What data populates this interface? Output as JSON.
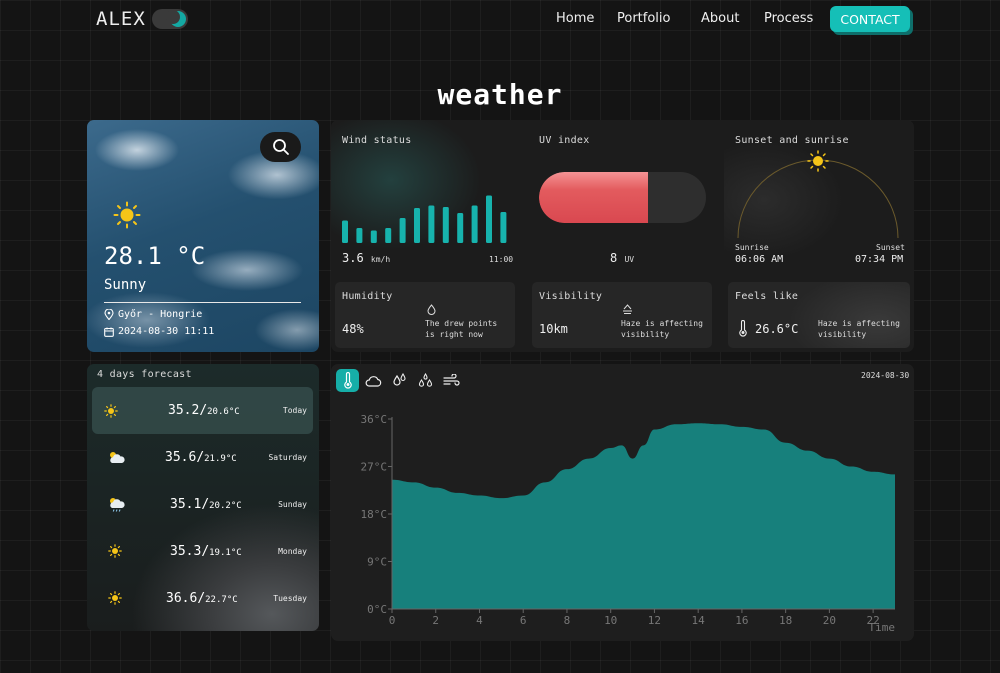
{
  "nav": {
    "logo": "ALEX",
    "links": [
      "Home",
      "Portfolio",
      "About",
      "Process"
    ],
    "contact": "CONTACT"
  },
  "page_title": "weather",
  "current": {
    "temperature": "28.1 °C",
    "condition": "Sunny",
    "location": "Győr - Hongrie",
    "datetime": "2024-08-30 11:11",
    "icon": "sun-icon"
  },
  "highlights": {
    "wind": {
      "label": "Wind status",
      "value": "3.6",
      "unit": "km/h",
      "time": "11:00",
      "bars": [
        0.45,
        0.3,
        0.25,
        0.3,
        0.5,
        0.7,
        0.75,
        0.72,
        0.6,
        0.75,
        0.95,
        0.62
      ]
    },
    "uv": {
      "label": "UV index",
      "value": "8",
      "unit": "UV",
      "level": 0.65
    },
    "sun": {
      "label": "Sunset and sunrise",
      "sunrise_label": "Sunrise",
      "sunrise": "06:06 AM",
      "sunset_label": "Sunset",
      "sunset": "07:34 PM"
    },
    "humidity": {
      "label": "Humidity",
      "value": "48%",
      "note": "The drew points is right now"
    },
    "visibility": {
      "label": "Visibility",
      "value": "10km",
      "note": "Haze is affecting visibility"
    },
    "feels": {
      "label": "Feels like",
      "value": "26.6°C",
      "note": "Haze is affecting visibility"
    }
  },
  "forecast": {
    "title": "4 days forecast",
    "days": [
      {
        "high": "35.2",
        "low": "20.6°C",
        "day": "Today",
        "icon": "sun-icon"
      },
      {
        "high": "35.6",
        "low": "21.9°C",
        "day": "Saturday",
        "icon": "partly-cloudy-icon"
      },
      {
        "high": "35.1",
        "low": "20.2°C",
        "day": "Sunday",
        "icon": "partly-cloudy-rain-icon"
      },
      {
        "high": "35.3",
        "low": "19.1°C",
        "day": "Monday",
        "icon": "sun-icon"
      },
      {
        "high": "36.6",
        "low": "22.7°C",
        "day": "Tuesday",
        "icon": "sun-icon"
      }
    ]
  },
  "chart": {
    "date": "2024-08-30",
    "tabs": [
      "thermometer-icon",
      "cloud-icon",
      "droplets-icon",
      "humidity-drops-icon",
      "wind-icon"
    ],
    "accent": "#17807c"
  },
  "chart_data": {
    "type": "area",
    "x": [
      0,
      1,
      2,
      3,
      4,
      5,
      6,
      7,
      8,
      9,
      10,
      10.5,
      11,
      11.5,
      12,
      13,
      14,
      15,
      16,
      17,
      18,
      19,
      20,
      21,
      22,
      23
    ],
    "values": [
      24.5,
      24,
      23,
      22,
      21.5,
      21,
      21.5,
      24,
      26.5,
      28.5,
      30.5,
      31,
      28.5,
      31,
      34,
      35,
      35.2,
      35,
      34.5,
      34,
      31.5,
      30,
      28.5,
      27,
      26,
      25.5
    ],
    "xlabel": "Time",
    "ylabel": "",
    "x_ticks": [
      "0",
      "2",
      "4",
      "6",
      "8",
      "10",
      "12",
      "14",
      "16",
      "18",
      "20",
      "22"
    ],
    "y_ticks": [
      "0°C",
      "9°C",
      "18°C",
      "27°C",
      "36°C"
    ],
    "ylim": [
      0,
      36
    ],
    "xlim": [
      0,
      23
    ],
    "color": "#17807c",
    "grid": false
  }
}
